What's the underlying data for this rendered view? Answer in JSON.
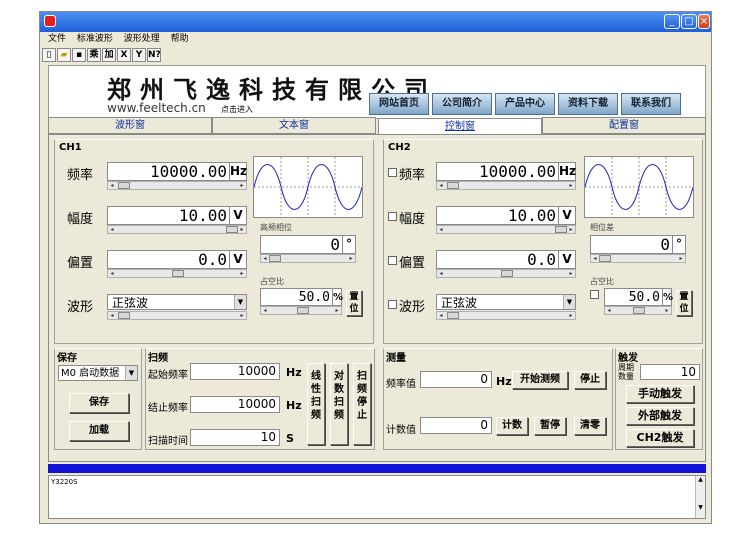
{
  "menu": [
    "文件",
    "标准波形",
    "波形处理",
    "帮助"
  ],
  "toolbar": [
    "乘",
    "加",
    "X",
    "Y",
    "N?"
  ],
  "banner": {
    "logo": "郑州飞逸科技有限公司",
    "url": "www.feeltech.cn",
    "enter": "点击进入",
    "nav": [
      "网站首页",
      "公司简介",
      "产品中心",
      "资料下载",
      "联系我们"
    ]
  },
  "tabs": [
    "波形窗",
    "文本窗",
    "控制窗",
    "配置窗"
  ],
  "ch1": {
    "title": "CH1",
    "freq_label": "频率",
    "freq": "10000.00",
    "freq_unit": "Hz",
    "amp_label": "幅度",
    "amp": "10.00",
    "amp_unit": "V",
    "offset_label": "偏置",
    "offset": "0.0",
    "offset_unit": "V",
    "wave_label": "波形",
    "wave": "正弦波",
    "phase_label": "高频相位",
    "phase": "0",
    "phase_unit": "°",
    "duty_label": "占空比",
    "duty": "50.0",
    "duty_unit": "%",
    "reset": "置位"
  },
  "ch2": {
    "title": "CH2",
    "freq_label": "频率",
    "freq": "10000.00",
    "freq_unit": "Hz",
    "amp_label": "幅度",
    "amp": "10.00",
    "amp_unit": "V",
    "offset_label": "偏置",
    "offset": "0.0",
    "offset_unit": "V",
    "wave_label": "波形",
    "wave": "正弦波",
    "phase_label": "相位差",
    "phase": "0",
    "phase_unit": "°",
    "duty_label": "占空比",
    "duty": "50.0",
    "duty_unit": "%",
    "reset": "置位"
  },
  "save": {
    "title": "保存",
    "slot": "M0 启动数据",
    "save_btn": "保存",
    "load_btn": "加载"
  },
  "sweep": {
    "title": "扫频",
    "start_label": "起始频率",
    "start": "10000",
    "start_unit": "Hz",
    "stop_label": "结止频率",
    "stop": "10000",
    "stop_unit": "Hz",
    "time_label": "扫描时间",
    "time": "10",
    "time_unit": "S",
    "lin": "线性扫频",
    "log": "对数扫频",
    "stop_btn": "扫频停止"
  },
  "measure": {
    "title": "测量",
    "freq_label": "频率值",
    "freq": "0",
    "freq_unit": "Hz",
    "start_btn": "开始测频",
    "stop_btn": "停止",
    "count_label": "计数值",
    "count": "0",
    "count_btn": "计数",
    "pause_btn": "暂停",
    "clear_btn": "清零"
  },
  "trigger": {
    "title": "触发",
    "period_label": "周期数量",
    "period": "10",
    "manual": "手动触发",
    "external": "外部触发",
    "ch2": "CH2触发"
  },
  "log": "Y3220S"
}
